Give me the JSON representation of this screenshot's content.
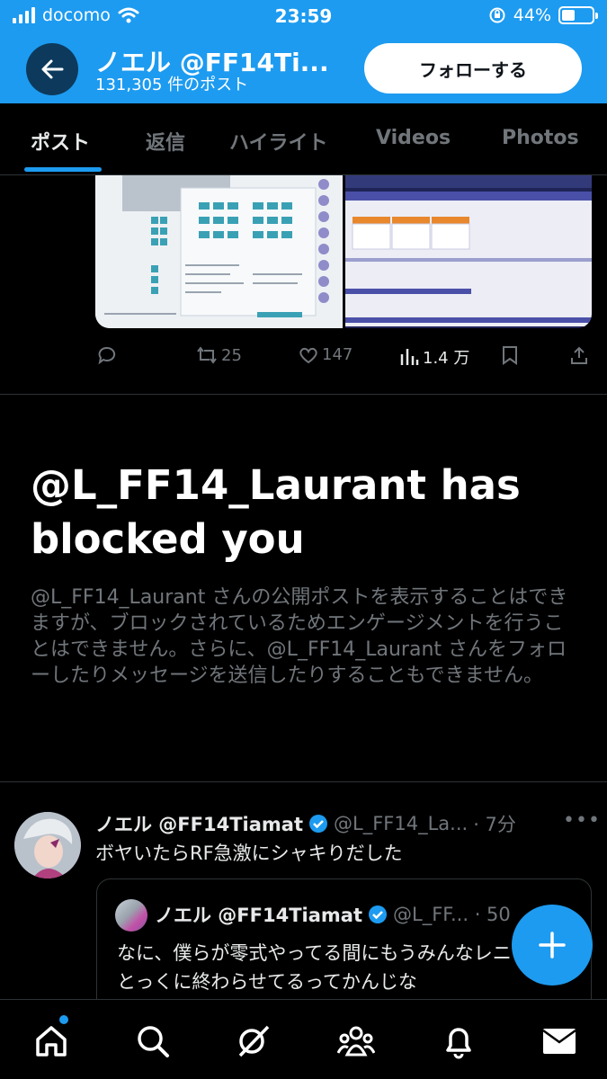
{
  "status_bar": {
    "carrier": "docomo",
    "time": "23:59",
    "battery": "44%"
  },
  "header": {
    "title": "ノエル @FF14Ti...",
    "subtitle": "131,305 件のポスト",
    "follow_label": "フォローする"
  },
  "tabs": [
    {
      "label": "ポスト",
      "active": true
    },
    {
      "label": "返信"
    },
    {
      "label": "ハイライト"
    },
    {
      "label": "Videos"
    },
    {
      "label": "Photos"
    }
  ],
  "post_actions": {
    "retweets": "25",
    "likes": "147",
    "views": "1.4 万"
  },
  "blocked": {
    "title": "@L_FF14_Laurant has blocked you",
    "body": "@L_FF14_Laurant さんの公開ポストを表示することはできますが、ブロックされているためエンゲージメントを行うことはできません。さらに、@L_FF14_Laurant さんをフォローしたりメッセージを送信したりすることもできません。"
  },
  "tweet": {
    "name": "ノエル @FF14Tiamat",
    "meta": "@L_FF14_La...",
    "time": "· 7分",
    "text": "ボヤいたらRF急激にシャキりだした",
    "quote": {
      "name": "ノエル @FF14Tiamat",
      "meta": "@L_FF... · 50",
      "text": "なに、僕らが零式やってる間にもうみんなレニアとかとっくに終わらせてるってかんじな"
    }
  },
  "colors": {
    "accent": "#1d9bf0",
    "muted": "#71767b",
    "background": "#000000"
  }
}
